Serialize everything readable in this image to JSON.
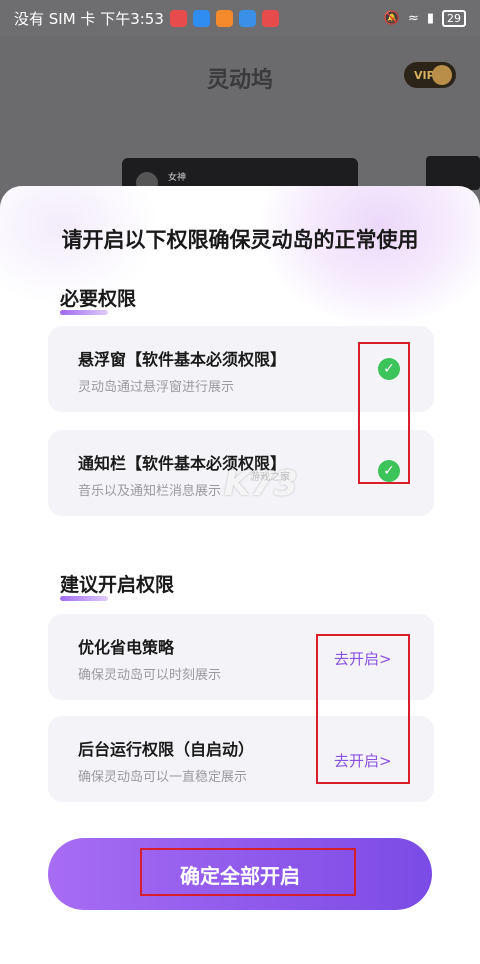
{
  "status_bar": {
    "carrier": "没有 SIM 卡 下午3:53",
    "battery": "29",
    "app_icons": [
      "#e84b4b",
      "#2f8cf0",
      "#f58a2c",
      "#3a8fe8",
      "#e84b4b"
    ]
  },
  "background_app": {
    "title": "灵动坞",
    "vip_label": "VIP",
    "card_name": "女神"
  },
  "sheet": {
    "title": "请开启以下权限确保灵动岛的正常使用",
    "required_section": {
      "title": "必要权限",
      "items": [
        {
          "title": "悬浮窗【软件基本必须权限】",
          "subtitle": "灵动岛通过悬浮窗进行展示",
          "status_icon": "check-circle-icon"
        },
        {
          "title": "通知栏【软件基本必须权限】",
          "subtitle": "音乐以及通知栏消息展示",
          "status_icon": "check-circle-icon"
        }
      ]
    },
    "suggested_section": {
      "title": "建议开启权限",
      "items": [
        {
          "title": "优化省电策略",
          "subtitle": "确保灵动岛可以时刻展示",
          "action": "去开启>"
        },
        {
          "title": "后台运行权限（自启动）",
          "subtitle": "确保灵动岛可以一直稳定展示",
          "action": "去开启>"
        }
      ]
    },
    "confirm_button": "确定全部开启",
    "watermark": "K73",
    "watermark_sub": "游戏之家"
  },
  "colors": {
    "accent": "#8a52e0",
    "button_gradient_start": "#a76cf2",
    "button_gradient_end": "#7b4be6",
    "check_green": "#3cc45a",
    "highlight_red": "#d81e2a"
  }
}
